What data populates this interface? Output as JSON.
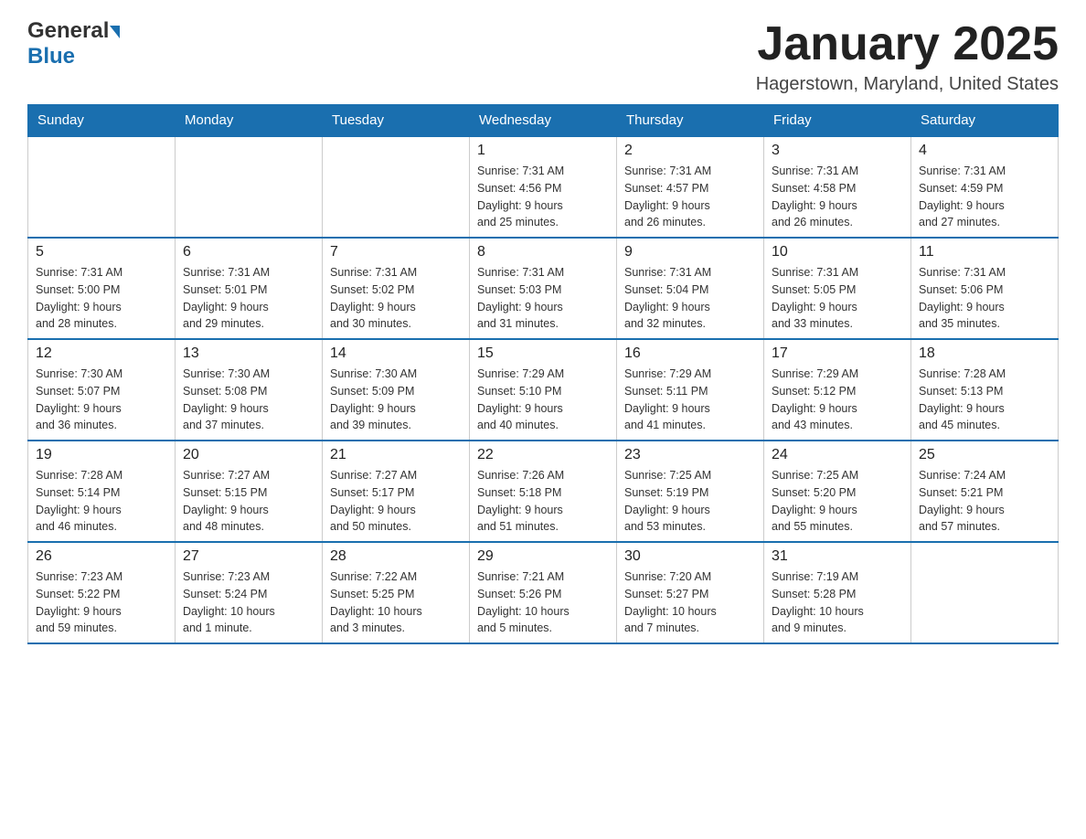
{
  "header": {
    "title": "January 2025",
    "location": "Hagerstown, Maryland, United States",
    "logo_general": "General",
    "logo_blue": "Blue"
  },
  "days_of_week": [
    "Sunday",
    "Monday",
    "Tuesday",
    "Wednesday",
    "Thursday",
    "Friday",
    "Saturday"
  ],
  "weeks": [
    [
      {
        "day": "",
        "info": ""
      },
      {
        "day": "",
        "info": ""
      },
      {
        "day": "",
        "info": ""
      },
      {
        "day": "1",
        "info": "Sunrise: 7:31 AM\nSunset: 4:56 PM\nDaylight: 9 hours\nand 25 minutes."
      },
      {
        "day": "2",
        "info": "Sunrise: 7:31 AM\nSunset: 4:57 PM\nDaylight: 9 hours\nand 26 minutes."
      },
      {
        "day": "3",
        "info": "Sunrise: 7:31 AM\nSunset: 4:58 PM\nDaylight: 9 hours\nand 26 minutes."
      },
      {
        "day": "4",
        "info": "Sunrise: 7:31 AM\nSunset: 4:59 PM\nDaylight: 9 hours\nand 27 minutes."
      }
    ],
    [
      {
        "day": "5",
        "info": "Sunrise: 7:31 AM\nSunset: 5:00 PM\nDaylight: 9 hours\nand 28 minutes."
      },
      {
        "day": "6",
        "info": "Sunrise: 7:31 AM\nSunset: 5:01 PM\nDaylight: 9 hours\nand 29 minutes."
      },
      {
        "day": "7",
        "info": "Sunrise: 7:31 AM\nSunset: 5:02 PM\nDaylight: 9 hours\nand 30 minutes."
      },
      {
        "day": "8",
        "info": "Sunrise: 7:31 AM\nSunset: 5:03 PM\nDaylight: 9 hours\nand 31 minutes."
      },
      {
        "day": "9",
        "info": "Sunrise: 7:31 AM\nSunset: 5:04 PM\nDaylight: 9 hours\nand 32 minutes."
      },
      {
        "day": "10",
        "info": "Sunrise: 7:31 AM\nSunset: 5:05 PM\nDaylight: 9 hours\nand 33 minutes."
      },
      {
        "day": "11",
        "info": "Sunrise: 7:31 AM\nSunset: 5:06 PM\nDaylight: 9 hours\nand 35 minutes."
      }
    ],
    [
      {
        "day": "12",
        "info": "Sunrise: 7:30 AM\nSunset: 5:07 PM\nDaylight: 9 hours\nand 36 minutes."
      },
      {
        "day": "13",
        "info": "Sunrise: 7:30 AM\nSunset: 5:08 PM\nDaylight: 9 hours\nand 37 minutes."
      },
      {
        "day": "14",
        "info": "Sunrise: 7:30 AM\nSunset: 5:09 PM\nDaylight: 9 hours\nand 39 minutes."
      },
      {
        "day": "15",
        "info": "Sunrise: 7:29 AM\nSunset: 5:10 PM\nDaylight: 9 hours\nand 40 minutes."
      },
      {
        "day": "16",
        "info": "Sunrise: 7:29 AM\nSunset: 5:11 PM\nDaylight: 9 hours\nand 41 minutes."
      },
      {
        "day": "17",
        "info": "Sunrise: 7:29 AM\nSunset: 5:12 PM\nDaylight: 9 hours\nand 43 minutes."
      },
      {
        "day": "18",
        "info": "Sunrise: 7:28 AM\nSunset: 5:13 PM\nDaylight: 9 hours\nand 45 minutes."
      }
    ],
    [
      {
        "day": "19",
        "info": "Sunrise: 7:28 AM\nSunset: 5:14 PM\nDaylight: 9 hours\nand 46 minutes."
      },
      {
        "day": "20",
        "info": "Sunrise: 7:27 AM\nSunset: 5:15 PM\nDaylight: 9 hours\nand 48 minutes."
      },
      {
        "day": "21",
        "info": "Sunrise: 7:27 AM\nSunset: 5:17 PM\nDaylight: 9 hours\nand 50 minutes."
      },
      {
        "day": "22",
        "info": "Sunrise: 7:26 AM\nSunset: 5:18 PM\nDaylight: 9 hours\nand 51 minutes."
      },
      {
        "day": "23",
        "info": "Sunrise: 7:25 AM\nSunset: 5:19 PM\nDaylight: 9 hours\nand 53 minutes."
      },
      {
        "day": "24",
        "info": "Sunrise: 7:25 AM\nSunset: 5:20 PM\nDaylight: 9 hours\nand 55 minutes."
      },
      {
        "day": "25",
        "info": "Sunrise: 7:24 AM\nSunset: 5:21 PM\nDaylight: 9 hours\nand 57 minutes."
      }
    ],
    [
      {
        "day": "26",
        "info": "Sunrise: 7:23 AM\nSunset: 5:22 PM\nDaylight: 9 hours\nand 59 minutes."
      },
      {
        "day": "27",
        "info": "Sunrise: 7:23 AM\nSunset: 5:24 PM\nDaylight: 10 hours\nand 1 minute."
      },
      {
        "day": "28",
        "info": "Sunrise: 7:22 AM\nSunset: 5:25 PM\nDaylight: 10 hours\nand 3 minutes."
      },
      {
        "day": "29",
        "info": "Sunrise: 7:21 AM\nSunset: 5:26 PM\nDaylight: 10 hours\nand 5 minutes."
      },
      {
        "day": "30",
        "info": "Sunrise: 7:20 AM\nSunset: 5:27 PM\nDaylight: 10 hours\nand 7 minutes."
      },
      {
        "day": "31",
        "info": "Sunrise: 7:19 AM\nSunset: 5:28 PM\nDaylight: 10 hours\nand 9 minutes."
      },
      {
        "day": "",
        "info": ""
      }
    ]
  ],
  "accent_color": "#1a6faf"
}
